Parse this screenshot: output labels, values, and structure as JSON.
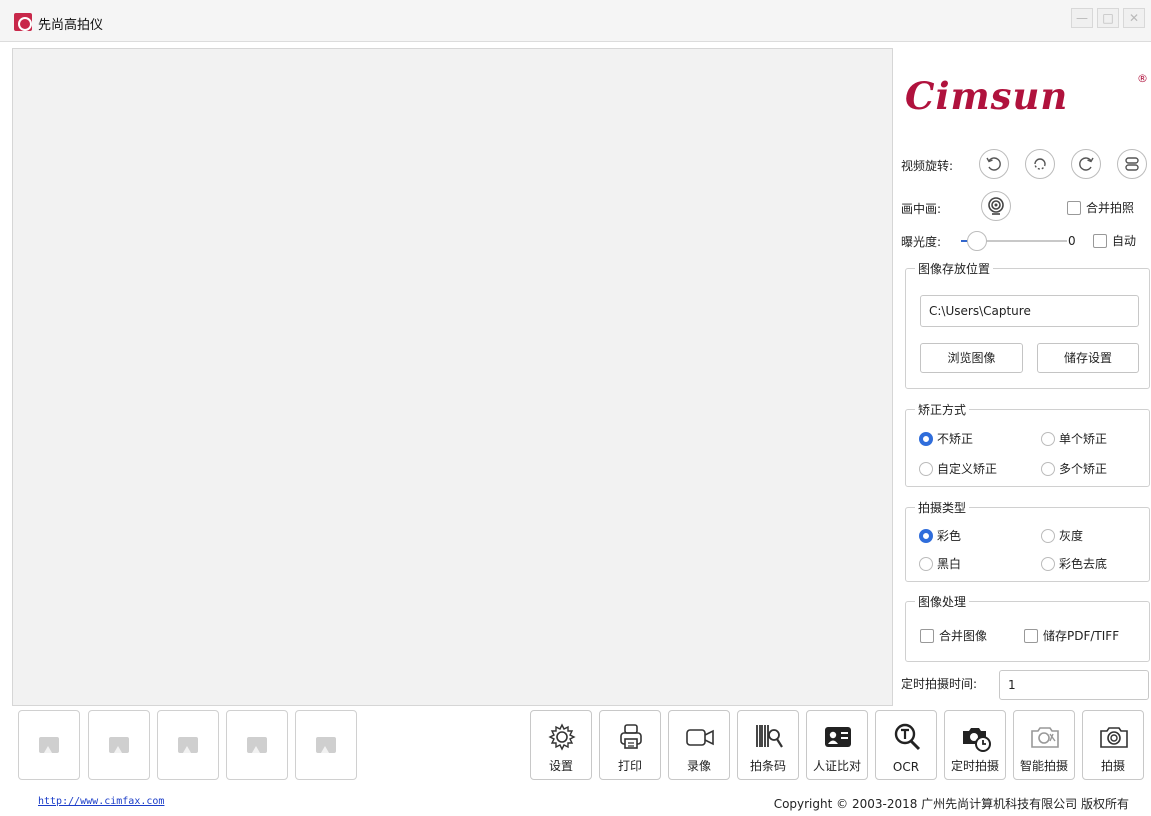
{
  "window": {
    "title": "先尚高拍仪"
  },
  "brand": {
    "logo_text": "Cimsun",
    "registered_mark": "®"
  },
  "controls": {
    "rotate_label": "视频旋转:",
    "pip_label": "画中画:",
    "merge_photo_label": "合并拍照",
    "exposure_label": "曝光度:",
    "exposure_value": "0",
    "exposure_level": 0,
    "auto_label": "自动"
  },
  "storage": {
    "title": "图像存放位置",
    "path": "C:\\Users\\Capture",
    "browse_label": "浏览图像",
    "settings_label": "储存设置"
  },
  "correction": {
    "title": "矫正方式",
    "options": [
      "不矫正",
      "单个矫正",
      "自定义矫正",
      "多个矫正"
    ],
    "selected": "不矫正"
  },
  "capture_type": {
    "title": "拍摄类型",
    "options": [
      "彩色",
      "灰度",
      "黑白",
      "彩色去底"
    ],
    "selected": "彩色"
  },
  "processing": {
    "title": "图像处理",
    "merge_image_label": "合并图像",
    "save_pdf_label": "储存PDF/TIFF"
  },
  "timer": {
    "label": "定时拍摄时间:",
    "value": "1"
  },
  "toolbar": [
    {
      "label": "设置",
      "icon": "gear-icon"
    },
    {
      "label": "打印",
      "icon": "printer-icon"
    },
    {
      "label": "录像",
      "icon": "video-icon"
    },
    {
      "label": "拍条码",
      "icon": "barcode-icon"
    },
    {
      "label": "人证比对",
      "icon": "id-card-icon"
    },
    {
      "label": "OCR",
      "icon": "ocr-search-icon"
    },
    {
      "label": "定时拍摄",
      "icon": "timer-camera-icon"
    },
    {
      "label": "智能拍摄",
      "icon": "smart-camera-icon"
    },
    {
      "label": "拍摄",
      "icon": "camera-icon"
    }
  ],
  "footer": {
    "link": "http://www.cimfax.com",
    "copyright": "Copyright © 2003-2018 广州先尚计算机科技有限公司 版权所有"
  }
}
